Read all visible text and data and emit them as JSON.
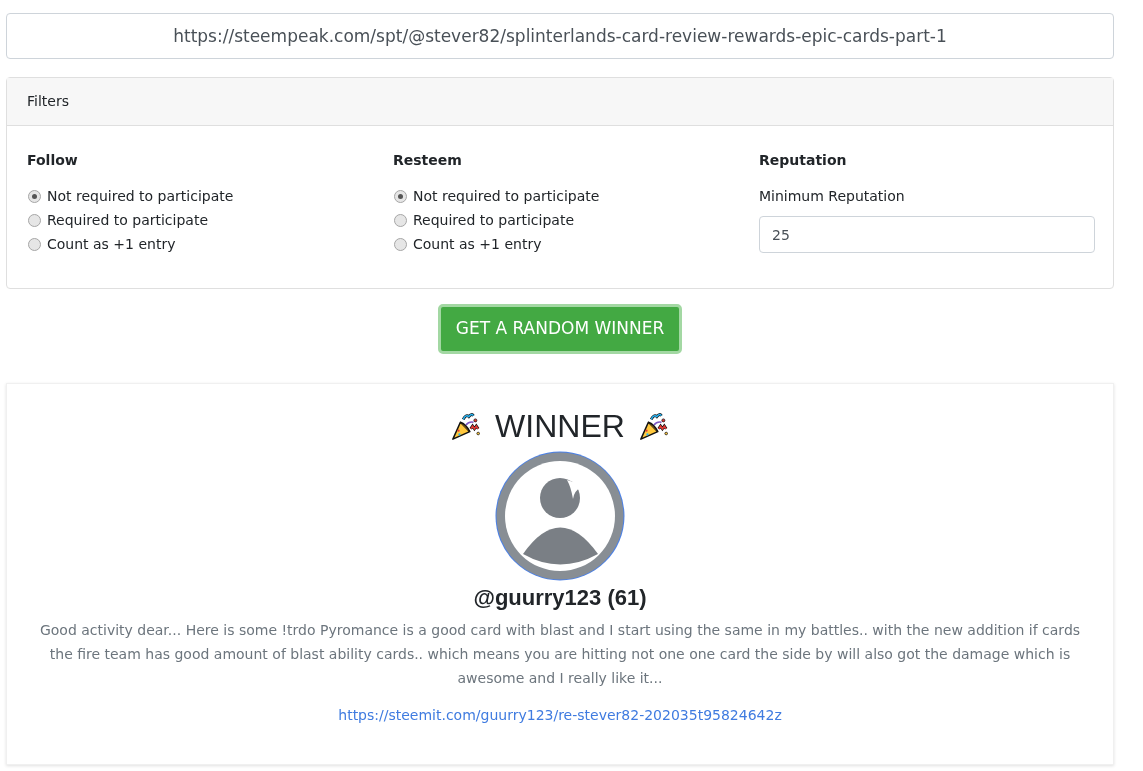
{
  "url_field": {
    "value": "https://steempeak.com/spt/@stever82/splinterlands-card-review-rewards-epic-cards-part-1"
  },
  "filters": {
    "title": "Filters",
    "groups": [
      {
        "kind": "radio",
        "title": "Follow",
        "options": [
          {
            "label": "Not required to participate",
            "selected": true
          },
          {
            "label": "Required to participate",
            "selected": false
          },
          {
            "label": "Count as +1 entry",
            "selected": false
          }
        ]
      },
      {
        "kind": "radio",
        "title": "Resteem",
        "options": [
          {
            "label": "Not required to participate",
            "selected": true
          },
          {
            "label": "Required to participate",
            "selected": false
          },
          {
            "label": "Count as +1 entry",
            "selected": false
          }
        ]
      },
      {
        "kind": "number",
        "title": "Reputation",
        "label": "Minimum Reputation",
        "value": "25"
      }
    ]
  },
  "action_button": {
    "label": "GET A RANDOM WINNER"
  },
  "winner": {
    "title": "WINNER",
    "username": "@guurry123 (61)",
    "comment": "Good activity dear... Here is some !trdo Pyromance is a good card with blast and I start using the same in my battles.. with the new addition if cards the fire team has good amount of blast ability cards.. which means you are hitting not one one card the side by will also got the damage which is awesome and I really like it...",
    "link": "https://steemit.com/guurry123/re-stever82-202035t95824642z"
  }
}
